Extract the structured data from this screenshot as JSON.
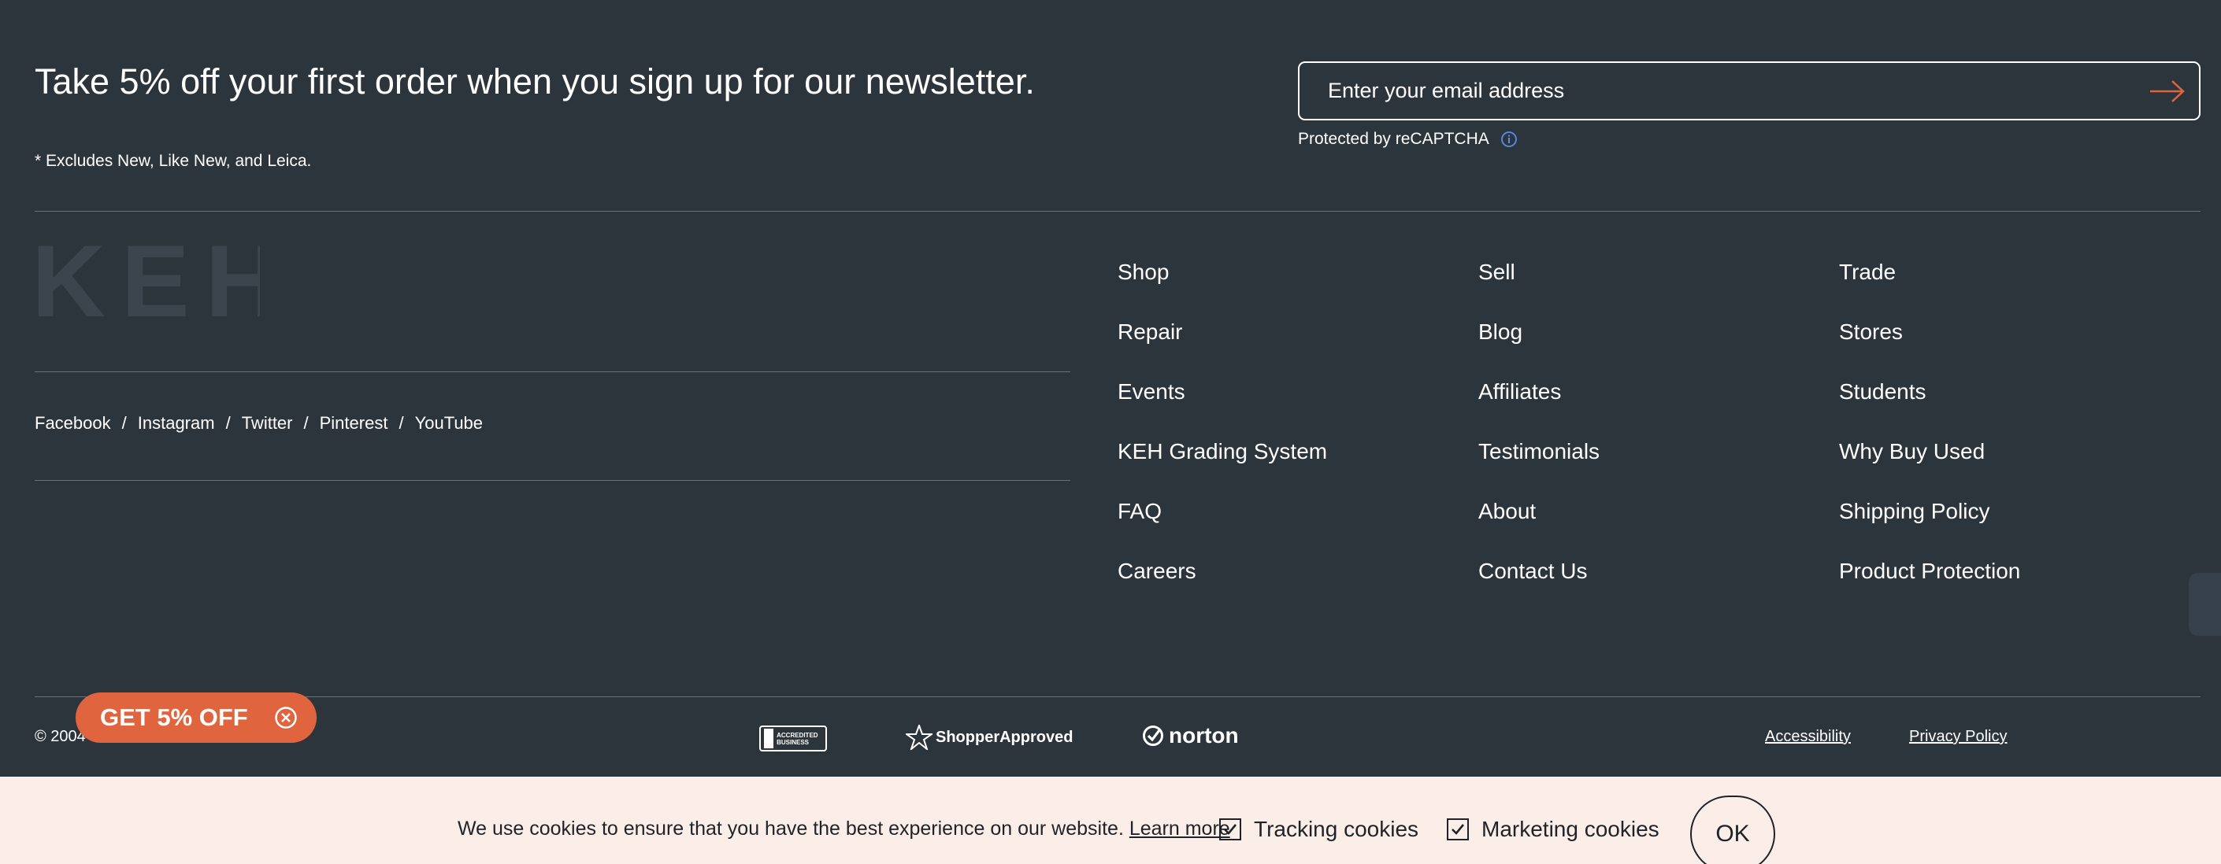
{
  "newsletter": {
    "headline": "Take 5% off your first order when you sign up for our newsletter.",
    "excludes": "* Excludes New, Like New, and Leica.",
    "email_placeholder": "Enter your email address",
    "recaptcha_text": "Protected by reCAPTCHA"
  },
  "logo_text": "KEH",
  "social": {
    "links": [
      "Facebook",
      "Instagram",
      "Twitter",
      "Pinterest",
      "YouTube"
    ],
    "separator": "/"
  },
  "nav": {
    "col1": [
      "Shop",
      "Repair",
      "Events",
      "KEH Grading System",
      "FAQ",
      "Careers"
    ],
    "col2": [
      "Sell",
      "Blog",
      "Affiliates",
      "Testimonials",
      "About",
      "Contact Us"
    ],
    "col3": [
      "Trade",
      "Stores",
      "Students",
      "Why Buy Used",
      "Shipping Policy",
      "Product Protection"
    ]
  },
  "footer": {
    "copyright": "© 2004",
    "promo_label": "GET 5% OFF",
    "bbb_text": "ACCREDITED BUSINESS",
    "shopper_approved": "ShopperApproved",
    "norton": "norton",
    "accessibility": "Accessibility",
    "privacy": "Privacy Policy"
  },
  "cookies": {
    "message": "We use cookies to ensure that you have the best experience on our website.",
    "learn_more": "Learn more",
    "tracking_label": "Tracking cookies",
    "marketing_label": "Marketing cookies",
    "tracking_checked": true,
    "marketing_checked": true,
    "ok_label": "OK"
  },
  "colors": {
    "background": "#2d353c",
    "accent": "#e0653f",
    "cookie_bar": "#fbeee8",
    "info_icon": "#5b8def"
  }
}
